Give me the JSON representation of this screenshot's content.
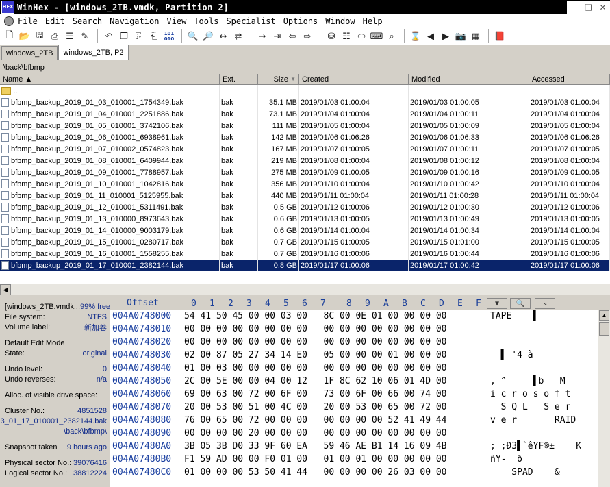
{
  "window": {
    "title": "WinHex - [windows_2TB.vmdk, Partition 2]",
    "logo_text": "HEX",
    "min": "–",
    "restore": "❏",
    "close": "✕"
  },
  "menu": [
    "File",
    "Edit",
    "Search",
    "Navigation",
    "View",
    "Tools",
    "Specialist",
    "Options",
    "Window",
    "Help"
  ],
  "tabs": [
    {
      "label": "windows_2TB",
      "active": false
    },
    {
      "label": "windows_2TB, P2",
      "active": true
    }
  ],
  "path": "\\back\\bfbmp",
  "files": {
    "headers": {
      "name": "Name ▲",
      "ext": "Ext.",
      "size": "Size",
      "created": "Created",
      "modified": "Modified",
      "accessed": "Accessed"
    },
    "parent": "..",
    "rows": [
      {
        "name": "bfbmp_backup_2019_01_03_010001_1754349.bak",
        "ext": "bak",
        "size": "35.1 MB",
        "created": "2019/01/03  01:00:04",
        "modified": "2019/01/03  01:00:05",
        "accessed": "2019/01/03  01:00:04"
      },
      {
        "name": "bfbmp_backup_2019_01_04_010001_2251886.bak",
        "ext": "bak",
        "size": "73.1 MB",
        "created": "2019/01/04  01:00:04",
        "modified": "2019/01/04  01:00:11",
        "accessed": "2019/01/04  01:00:04"
      },
      {
        "name": "bfbmp_backup_2019_01_05_010001_3742106.bak",
        "ext": "bak",
        "size": "111 MB",
        "created": "2019/01/05  01:00:04",
        "modified": "2019/01/05  01:00:09",
        "accessed": "2019/01/05  01:00:04"
      },
      {
        "name": "bfbmp_backup_2019_01_06_010001_6938961.bak",
        "ext": "bak",
        "size": "142 MB",
        "created": "2019/01/06  01:06:26",
        "modified": "2019/01/06  01:06:33",
        "accessed": "2019/01/06  01:06:26"
      },
      {
        "name": "bfbmp_backup_2019_01_07_010002_0574823.bak",
        "ext": "bak",
        "size": "167 MB",
        "created": "2019/01/07  01:00:05",
        "modified": "2019/01/07  01:00:11",
        "accessed": "2019/01/07  01:00:05"
      },
      {
        "name": "bfbmp_backup_2019_01_08_010001_6409944.bak",
        "ext": "bak",
        "size": "219 MB",
        "created": "2019/01/08  01:00:04",
        "modified": "2019/01/08  01:00:12",
        "accessed": "2019/01/08  01:00:04"
      },
      {
        "name": "bfbmp_backup_2019_01_09_010001_7788957.bak",
        "ext": "bak",
        "size": "275 MB",
        "created": "2019/01/09  01:00:05",
        "modified": "2019/01/09  01:00:16",
        "accessed": "2019/01/09  01:00:05"
      },
      {
        "name": "bfbmp_backup_2019_01_10_010001_1042816.bak",
        "ext": "bak",
        "size": "356 MB",
        "created": "2019/01/10  01:00:04",
        "modified": "2019/01/10  01:00:42",
        "accessed": "2019/01/10  01:00:04"
      },
      {
        "name": "bfbmp_backup_2019_01_11_010001_5125955.bak",
        "ext": "bak",
        "size": "440 MB",
        "created": "2019/01/11  01:00:04",
        "modified": "2019/01/11  01:00:28",
        "accessed": "2019/01/11  01:00:04"
      },
      {
        "name": "bfbmp_backup_2019_01_12_010001_5311491.bak",
        "ext": "bak",
        "size": "0.5 GB",
        "created": "2019/01/12  01:00:06",
        "modified": "2019/01/12  01:00:30",
        "accessed": "2019/01/12  01:00:06"
      },
      {
        "name": "bfbmp_backup_2019_01_13_010000_8973643.bak",
        "ext": "bak",
        "size": "0.6 GB",
        "created": "2019/01/13  01:00:05",
        "modified": "2019/01/13  01:00:49",
        "accessed": "2019/01/13  01:00:05"
      },
      {
        "name": "bfbmp_backup_2019_01_14_010000_9003179.bak",
        "ext": "bak",
        "size": "0.6 GB",
        "created": "2019/01/14  01:00:04",
        "modified": "2019/01/14  01:00:34",
        "accessed": "2019/01/14  01:00:04"
      },
      {
        "name": "bfbmp_backup_2019_01_15_010001_0280717.bak",
        "ext": "bak",
        "size": "0.7 GB",
        "created": "2019/01/15  01:00:05",
        "modified": "2019/01/15  01:01:00",
        "accessed": "2019/01/15  01:00:05"
      },
      {
        "name": "bfbmp_backup_2019_01_16_010001_1558255.bak",
        "ext": "bak",
        "size": "0.7 GB",
        "created": "2019/01/16  01:00:06",
        "modified": "2019/01/16  01:00:44",
        "accessed": "2019/01/16  01:00:06"
      },
      {
        "name": "bfbmp_backup_2019_01_17_010001_2382144.bak",
        "ext": "bak",
        "size": "0.8 GB",
        "created": "2019/01/17  01:00:06",
        "modified": "2019/01/17  01:00:42",
        "accessed": "2019/01/17  01:00:06",
        "selected": true
      }
    ]
  },
  "info": {
    "disk": "[windows_2TB.vmdk...",
    "free": "99% free",
    "fs_label": "File system:",
    "fs": "NTFS",
    "vol_label": "Volume label:",
    "vol": "新加卷",
    "edit_mode_label": "Default Edit Mode",
    "state_label": "State:",
    "state": "original",
    "undo_label": "Undo level:",
    "undo": "0",
    "undo_rev_label": "Undo reverses:",
    "undo_rev": "n/a",
    "alloc_label": "Alloc. of visible drive space:",
    "cluster_label": "Cluster No.:",
    "cluster": "4851528",
    "file_frag": "3_01_17_010001_2382144.bak",
    "file_path": "\\back\\bfbmp\\",
    "snapshot_label": "Snapshot taken",
    "snapshot": "9 hours ago",
    "phys_label": "Physical sector No.:",
    "phys": "39076416",
    "log_label": "Logical sector No.:",
    "log": "38812224"
  },
  "hex": {
    "offset_label": "Offset",
    "columns": [
      "0",
      "1",
      "2",
      "3",
      "4",
      "5",
      "6",
      "7",
      "8",
      "9",
      "A",
      "B",
      "C",
      "D",
      "E",
      "F"
    ],
    "rows": [
      {
        "off": "004A0748000",
        "bytes": "54 41 50 45 00 00 03 00   8C 00 0E 01 00 00 00 00",
        "text": "TAPE    ▌"
      },
      {
        "off": "004A0748010",
        "bytes": "00 00 00 00 00 00 00 00   00 00 00 00 00 00 00 00",
        "text": ""
      },
      {
        "off": "004A0748020",
        "bytes": "00 00 00 00 00 00 00 00   00 00 00 00 00 00 00 00",
        "text": ""
      },
      {
        "off": "004A0748030",
        "bytes": "02 00 87 05 27 34 14 E0   05 00 00 00 01 00 00 00",
        "text": "  ▌ '4 à"
      },
      {
        "off": "004A0748040",
        "bytes": "01 00 03 00 00 00 00 00   00 00 00 00 00 00 00 00",
        "text": ""
      },
      {
        "off": "004A0748050",
        "bytes": "2C 00 5E 00 00 04 00 12   1F 8C 62 10 06 01 4D 00",
        "text": ", ^     ▌b   M"
      },
      {
        "off": "004A0748060",
        "bytes": "69 00 63 00 72 00 6F 00   73 00 6F 00 66 00 74 00",
        "text": "i c r o s o f t"
      },
      {
        "off": "004A0748070",
        "bytes": "20 00 53 00 51 00 4C 00   20 00 53 00 65 00 72 00",
        "text": "  S Q L   S e r"
      },
      {
        "off": "004A0748080",
        "bytes": "76 00 65 00 72 00 00 00   00 00 00 00 52 41 49 44",
        "text": "v e r       RAID"
      },
      {
        "off": "004A0748090",
        "bytes": "00 00 00 00 20 00 00 00   00 00 00 00 00 00 00 00",
        "text": ""
      },
      {
        "off": "004A07480A0",
        "bytes": "3B 05 3B D0 33 9F 60 EA   59 46 AE B1 14 16 09 4B",
        "text": "; ;Ð3▌`êYF®±    K"
      },
      {
        "off": "004A07480B0",
        "bytes": "F1 59 AD 00 00 F0 01 00   01 00 01 00 00 00 00 00",
        "text": "ñY-  ð"
      },
      {
        "off": "004A07480C0",
        "bytes": "01 00 00 00 53 50 41 44   00 00 00 00 26 03 00 00",
        "text": "    SPAD    &"
      }
    ]
  }
}
